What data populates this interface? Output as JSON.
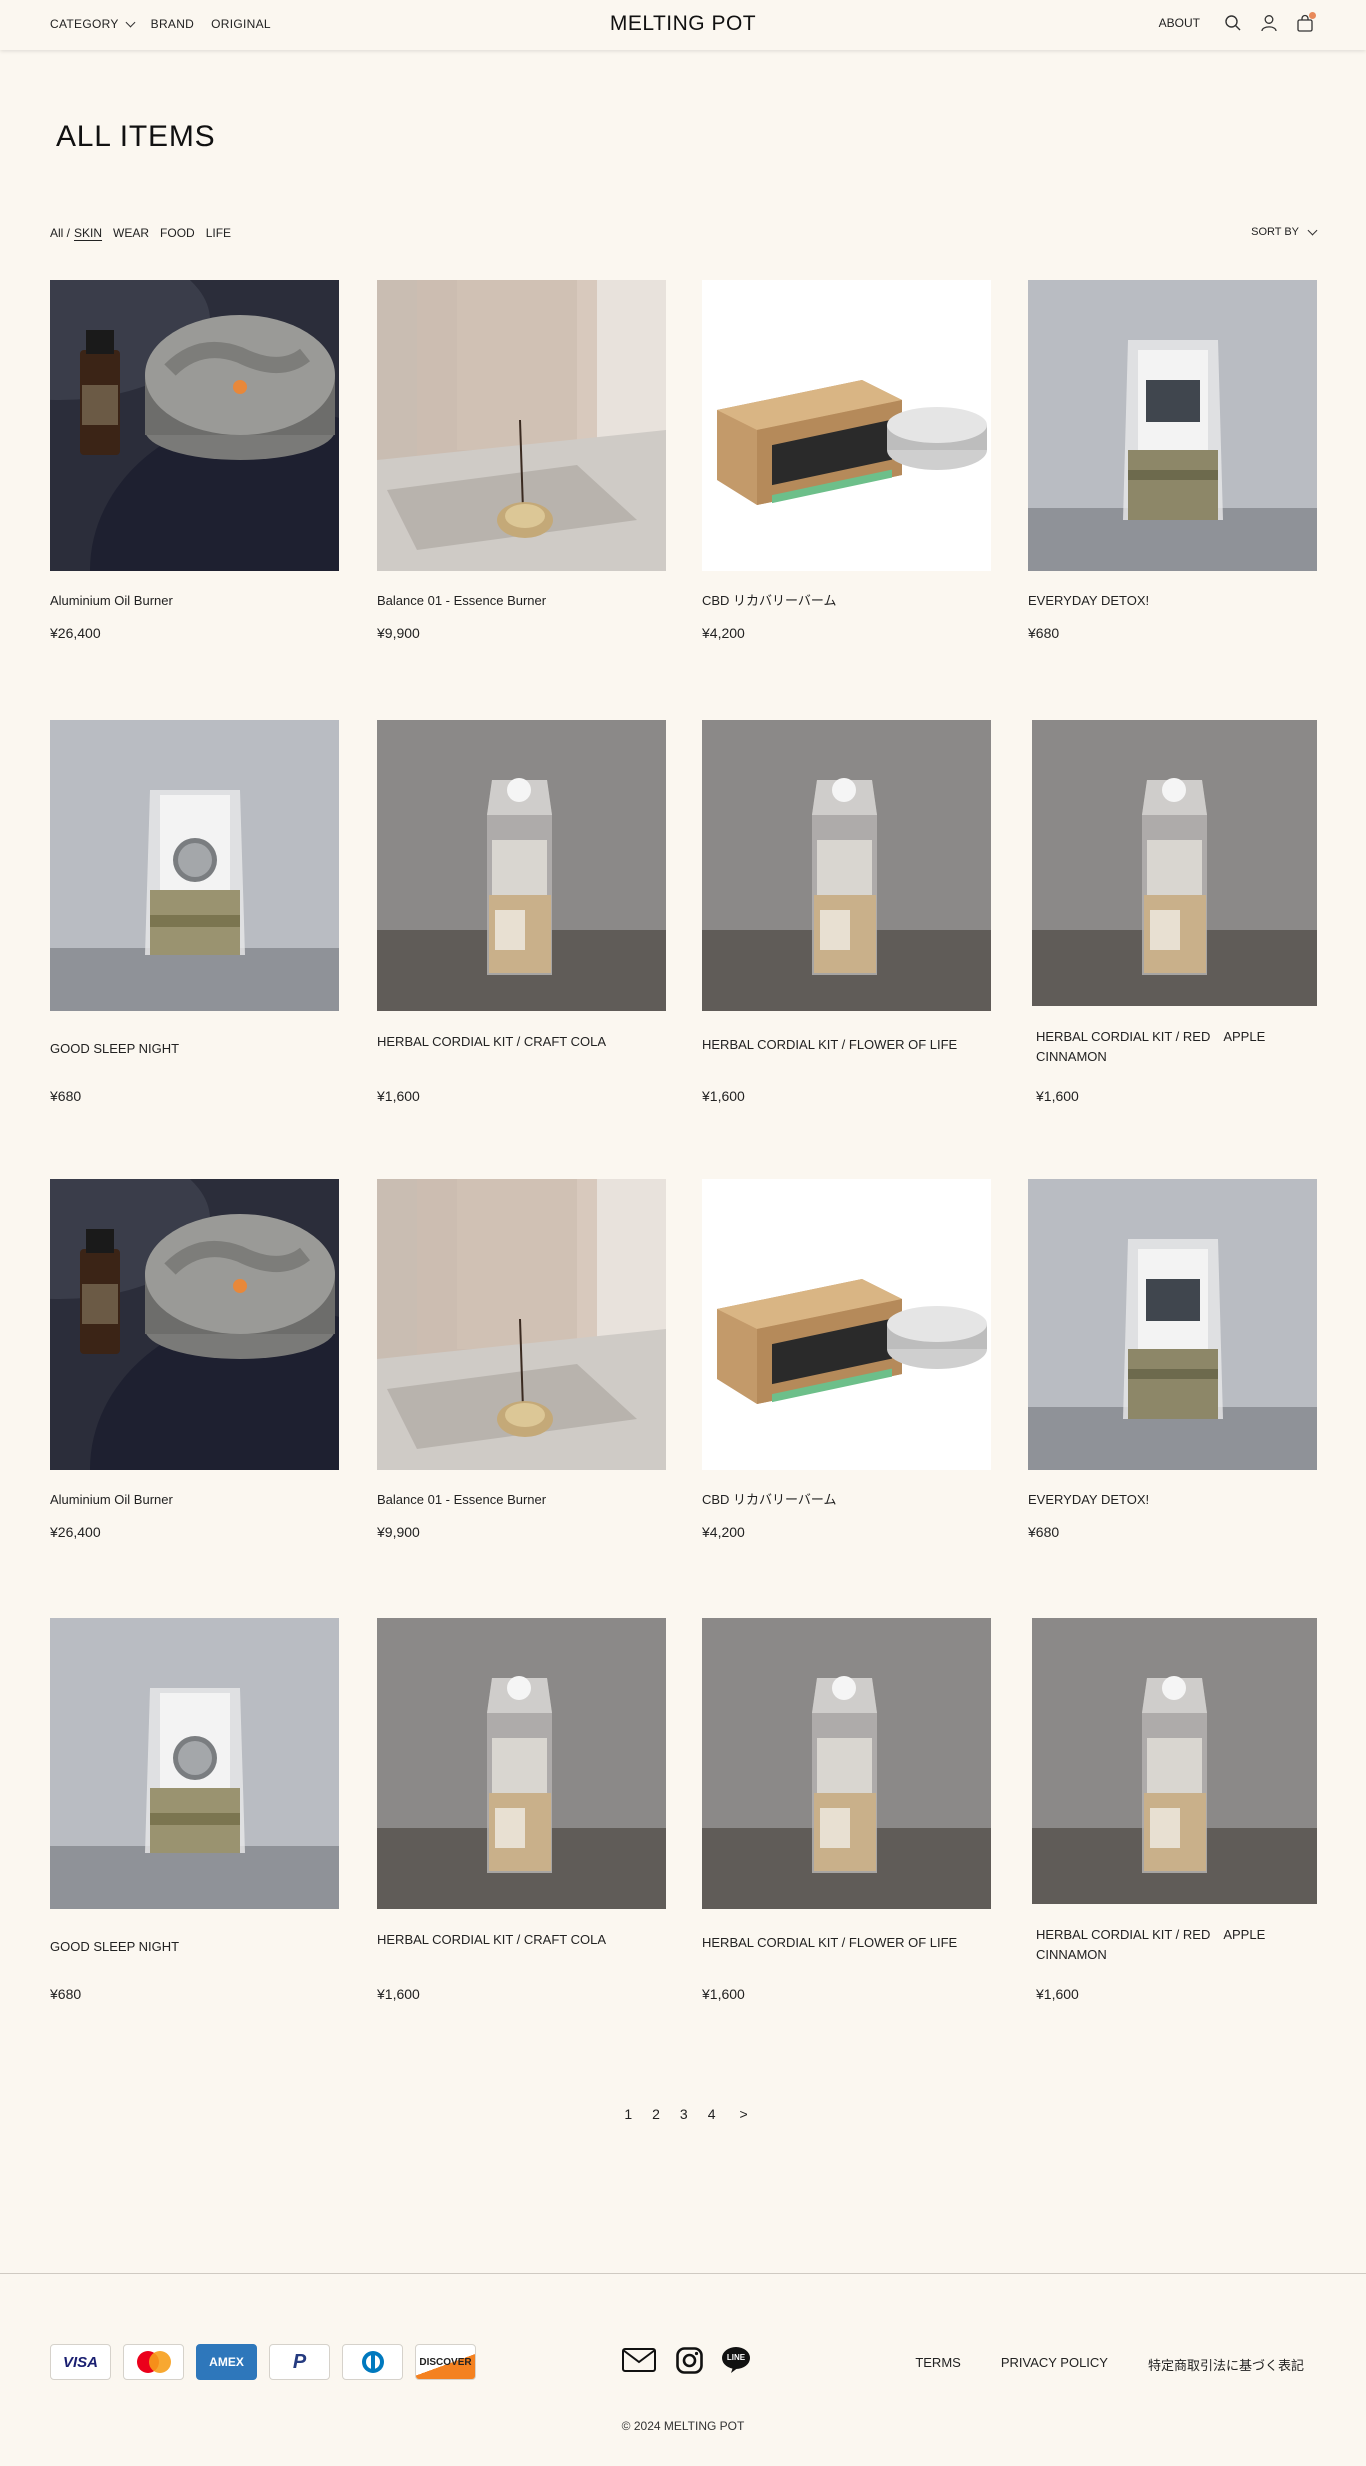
{
  "header": {
    "nav_left": [
      "CATEGORY",
      "BRAND",
      "ORIGINAL"
    ],
    "logo": "MELTING POT",
    "about": "ABOUT",
    "icons": [
      "search-icon",
      "user-icon",
      "cart-icon"
    ]
  },
  "page": {
    "title": "ALL ITEMS",
    "filter_all": "All /",
    "filters": [
      "SKIN",
      "WEAR",
      "FOOD",
      "LIFE"
    ],
    "active_filter": "SKIN",
    "sort_label": "SORT BY"
  },
  "products": [
    {
      "name": "Aluminium Oil Burner",
      "price": "¥26,400"
    },
    {
      "name": "Balance 01 - Essence Burner",
      "price": "¥9,900"
    },
    {
      "name": "CBD リカバリーバーム",
      "price": "¥4,200"
    },
    {
      "name": "EVERYDAY DETOX!",
      "price": "¥680"
    },
    {
      "name": "GOOD SLEEP NIGHT",
      "price": "¥680"
    },
    {
      "name": "HERBAL CORDIAL KIT / CRAFT COLA",
      "price": "¥1,600"
    },
    {
      "name": "HERBAL CORDIAL KIT / FLOWER OF LIFE",
      "price": "¥1,600"
    },
    {
      "name": "HERBAL CORDIAL KIT / RED　APPLE CINNAMON",
      "price": "¥1,600"
    },
    {
      "name": "Aluminium Oil Burner",
      "price": "¥26,400"
    },
    {
      "name": "Balance 01 - Essence Burner",
      "price": "¥9,900"
    },
    {
      "name": "CBD リカバリーバーム",
      "price": "¥4,200"
    },
    {
      "name": "EVERYDAY DETOX!",
      "price": "¥680"
    },
    {
      "name": "GOOD SLEEP NIGHT",
      "price": "¥680"
    },
    {
      "name": "HERBAL CORDIAL KIT / CRAFT COLA",
      "price": "¥1,600"
    },
    {
      "name": "HERBAL CORDIAL KIT / FLOWER OF LIFE",
      "price": "¥1,600"
    },
    {
      "name": "HERBAL CORDIAL KIT / RED　APPLE CINNAMON",
      "price": "¥1,600"
    }
  ],
  "pagination": {
    "pages": [
      "1",
      "2",
      "3",
      "4"
    ],
    "next": ">"
  },
  "footer": {
    "payments": [
      {
        "label": "VISA",
        "icon": "visa-icon"
      },
      {
        "label": "",
        "icon": "mastercard-icon"
      },
      {
        "label": "AMEX",
        "icon": "amex-icon"
      },
      {
        "label": "P",
        "icon": "paypal-icon"
      },
      {
        "label": "",
        "icon": "diners-icon"
      },
      {
        "label": "DISCOVER",
        "icon": "discover-icon"
      }
    ],
    "social": [
      "mail-icon",
      "instagram-icon",
      "line-icon"
    ],
    "line_label": "LINE",
    "links": [
      "TERMS",
      "PRIVACY POLICY",
      "特定商取引法に基づく表記"
    ],
    "copyright": "© 2024 MELTING POT"
  },
  "colors": {
    "background": "#fbf7f0",
    "text": "#222222",
    "cart_badge": "#e8895a"
  }
}
